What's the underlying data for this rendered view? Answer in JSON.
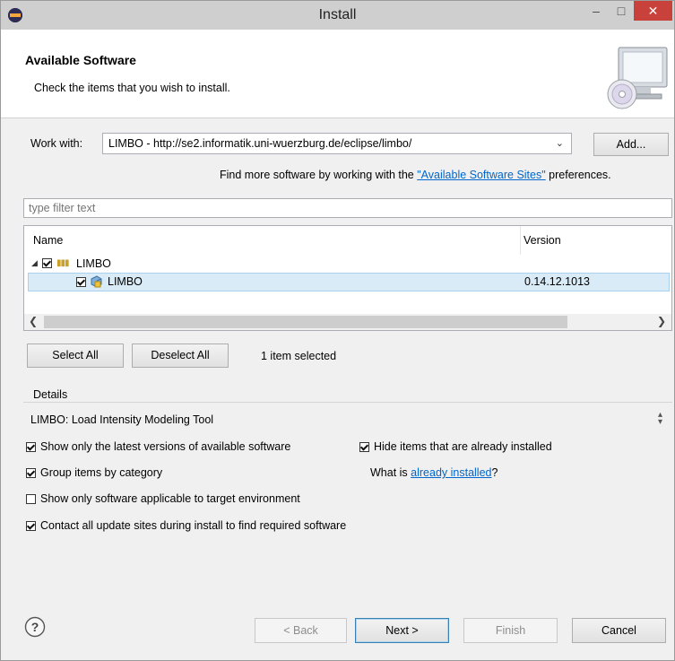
{
  "window": {
    "title": "Install"
  },
  "banner": {
    "heading": "Available Software",
    "description": "Check the items that you wish to install."
  },
  "work_with": {
    "label": "Work with:",
    "value": "LIMBO - http://se2.informatik.uni-wuerzburg.de/eclipse/limbo/",
    "add_label": "Add...",
    "hint_prefix": "Find more software by working with the ",
    "hint_link": "\"Available Software Sites\"",
    "hint_suffix": " preferences."
  },
  "filter": {
    "placeholder": "type filter text"
  },
  "tree": {
    "columns": [
      "Name",
      "Version"
    ],
    "rows": [
      {
        "name": "LIMBO",
        "version": "",
        "checked": true,
        "expanded": true
      },
      {
        "name": "LIMBO",
        "version": "0.14.12.1013",
        "checked": true,
        "selected": true
      }
    ]
  },
  "selection": {
    "select_all": "Select All",
    "deselect_all": "Deselect All",
    "status": "1 item selected"
  },
  "details": {
    "label": "Details",
    "text": "LIMBO: Load Intensity Modeling Tool"
  },
  "options": {
    "latest_only": {
      "label": "Show only the latest versions of available software",
      "checked": true
    },
    "hide_installed": {
      "label": "Hide items that are already installed",
      "checked": true
    },
    "group_by_category": {
      "label": "Group items by category",
      "checked": true
    },
    "what_is_prefix": "What is ",
    "what_is_link": "already installed",
    "what_is_suffix": "?",
    "target_env_only": {
      "label": "Show only software applicable to target environment",
      "checked": false
    },
    "contact_all": {
      "label": "Contact all update sites during install to find required software",
      "checked": true
    }
  },
  "footer": {
    "back": "< Back",
    "next": "Next >",
    "finish": "Finish",
    "cancel": "Cancel"
  },
  "colors": {
    "link": "#0066cc",
    "selection_bg": "#d9ebf7",
    "close_button": "#c9413b"
  }
}
